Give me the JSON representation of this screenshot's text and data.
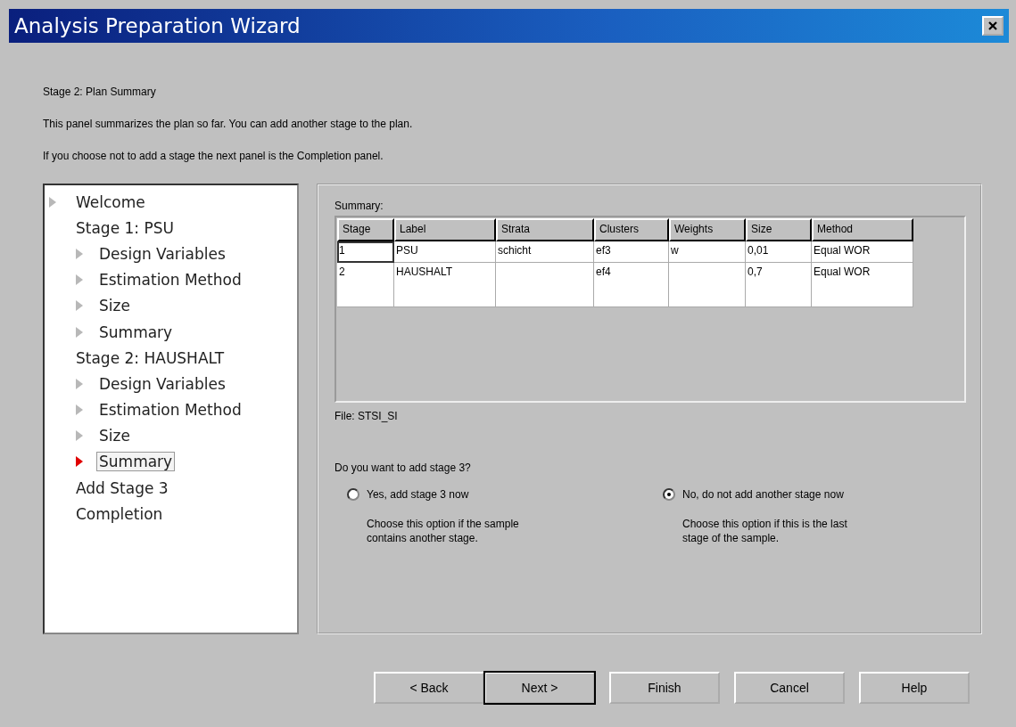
{
  "window": {
    "title": "Analysis Preparation Wizard"
  },
  "header": {
    "heading": "Stage 2: Plan Summary",
    "lines": [
      "This panel summarizes the plan so far.  You can add another stage to the plan.",
      "If you choose not to add a stage the next panel is the Completion panel."
    ]
  },
  "steps": [
    {
      "label": "Welcome",
      "kind": "step",
      "selected": false
    },
    {
      "label": "Stage 1: PSU",
      "kind": "heading",
      "children": [
        {
          "label": "Design Variables",
          "kind": "step",
          "selected": false
        },
        {
          "label": "Estimation Method",
          "kind": "step",
          "selected": false
        },
        {
          "label": "Size",
          "kind": "step",
          "selected": false
        },
        {
          "label": "Summary",
          "kind": "step",
          "selected": false
        }
      ]
    },
    {
      "label": "Stage 2: HAUSHALT",
      "kind": "heading",
      "children": [
        {
          "label": "Design Variables",
          "kind": "step",
          "selected": false
        },
        {
          "label": "Estimation Method",
          "kind": "step",
          "selected": false
        },
        {
          "label": "Size",
          "kind": "step",
          "selected": false
        },
        {
          "label": "Summary",
          "kind": "step",
          "selected": true
        }
      ]
    },
    {
      "label": "Add Stage 3",
      "kind": "heading"
    },
    {
      "label": "Completion",
      "kind": "heading"
    }
  ],
  "summary": {
    "label": "Summary:",
    "columns": [
      "Stage",
      "Label",
      "Strata",
      "Clusters",
      "Weights",
      "Size",
      "Method"
    ],
    "rows": [
      {
        "focused": true,
        "cells": [
          "1",
          "PSU",
          "schicht",
          "ef3",
          "w",
          "0,01",
          "Equal WOR"
        ]
      },
      {
        "focused": false,
        "cells": [
          "2",
          "HAUSHALT",
          null,
          "ef4",
          null,
          "0,7",
          "Equal WOR"
        ]
      }
    ],
    "file": "File: STSI_SI"
  },
  "question": "Do you want to add stage 3?",
  "options": [
    {
      "label": "Yes, add stage 3 now",
      "description": "Choose this option if the sample contains another stage.",
      "selected": false
    },
    {
      "label": "No, do not add another stage now",
      "description": "Choose this option if this is the last stage of the sample.",
      "selected": true
    }
  ],
  "buttons": [
    {
      "label": "< Back",
      "default": false
    },
    {
      "label": "Next >",
      "default": true
    },
    {
      "label": "Finish",
      "default": false
    },
    {
      "label": "Cancel",
      "default": false
    },
    {
      "label": "Help",
      "default": false
    }
  ]
}
